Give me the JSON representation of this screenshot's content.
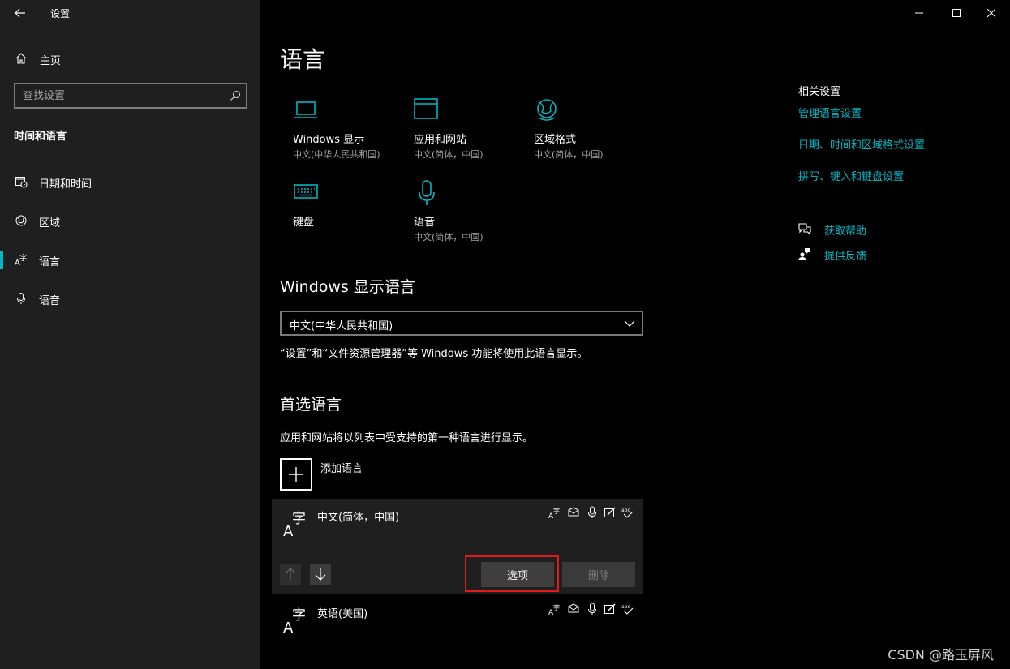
{
  "window": {
    "title": "设置"
  },
  "sidebar": {
    "home_label": "主页",
    "search_placeholder": "查找设置",
    "section_title": "时间和语言",
    "items": [
      {
        "label": "日期和时间",
        "icon": "calendar-clock-icon"
      },
      {
        "label": "区域",
        "icon": "globe-icon"
      },
      {
        "label": "语言",
        "icon": "language-icon",
        "active": true
      },
      {
        "label": "语音",
        "icon": "microphone-icon"
      }
    ]
  },
  "main": {
    "title": "语言",
    "tiles": [
      {
        "name": "Windows 显示",
        "sub": "中文(中华人民共和国)",
        "icon": "laptop-icon"
      },
      {
        "name": "应用和网站",
        "sub": "中文(简体，中国)",
        "icon": "window-icon"
      },
      {
        "name": "区域格式",
        "sub": "中文(简体，中国)",
        "icon": "globe-icon"
      },
      {
        "name": "键盘",
        "sub": "",
        "icon": "keyboard-icon"
      },
      {
        "name": "语音",
        "sub": "中文(简体，中国)",
        "icon": "microphone-icon"
      }
    ],
    "display_language": {
      "heading": "Windows 显示语言",
      "selected": "中文(中华人民共和国)",
      "description": "“设置”和“文件资源管理器”等 Windows 功能将使用此语言显示。"
    },
    "preferred": {
      "heading": "首选语言",
      "description": "应用和网站将以列表中受支持的第一种语言进行显示。",
      "add_label": "添加语言",
      "languages": [
        {
          "name": "中文(简体，中国)",
          "glyph": "A字",
          "options_label": "选项",
          "remove_label": "删除"
        },
        {
          "name": "英语(美国)",
          "glyph": "A字"
        }
      ]
    }
  },
  "related": {
    "title": "相关设置",
    "links": [
      "管理语言设置",
      "日期、时间和区域格式设置",
      "拼写、键入和键盘设置"
    ],
    "help": [
      {
        "label": "获取帮助",
        "icon": "help-chat-icon"
      },
      {
        "label": "提供反馈",
        "icon": "feedback-icon"
      }
    ]
  },
  "watermark": "CSDN @路玉屏风",
  "colors": {
    "accent": "#00b7c3",
    "sidebar_bg": "#1f1f1f",
    "main_bg": "#000000",
    "highlight": "#e01a1a"
  }
}
